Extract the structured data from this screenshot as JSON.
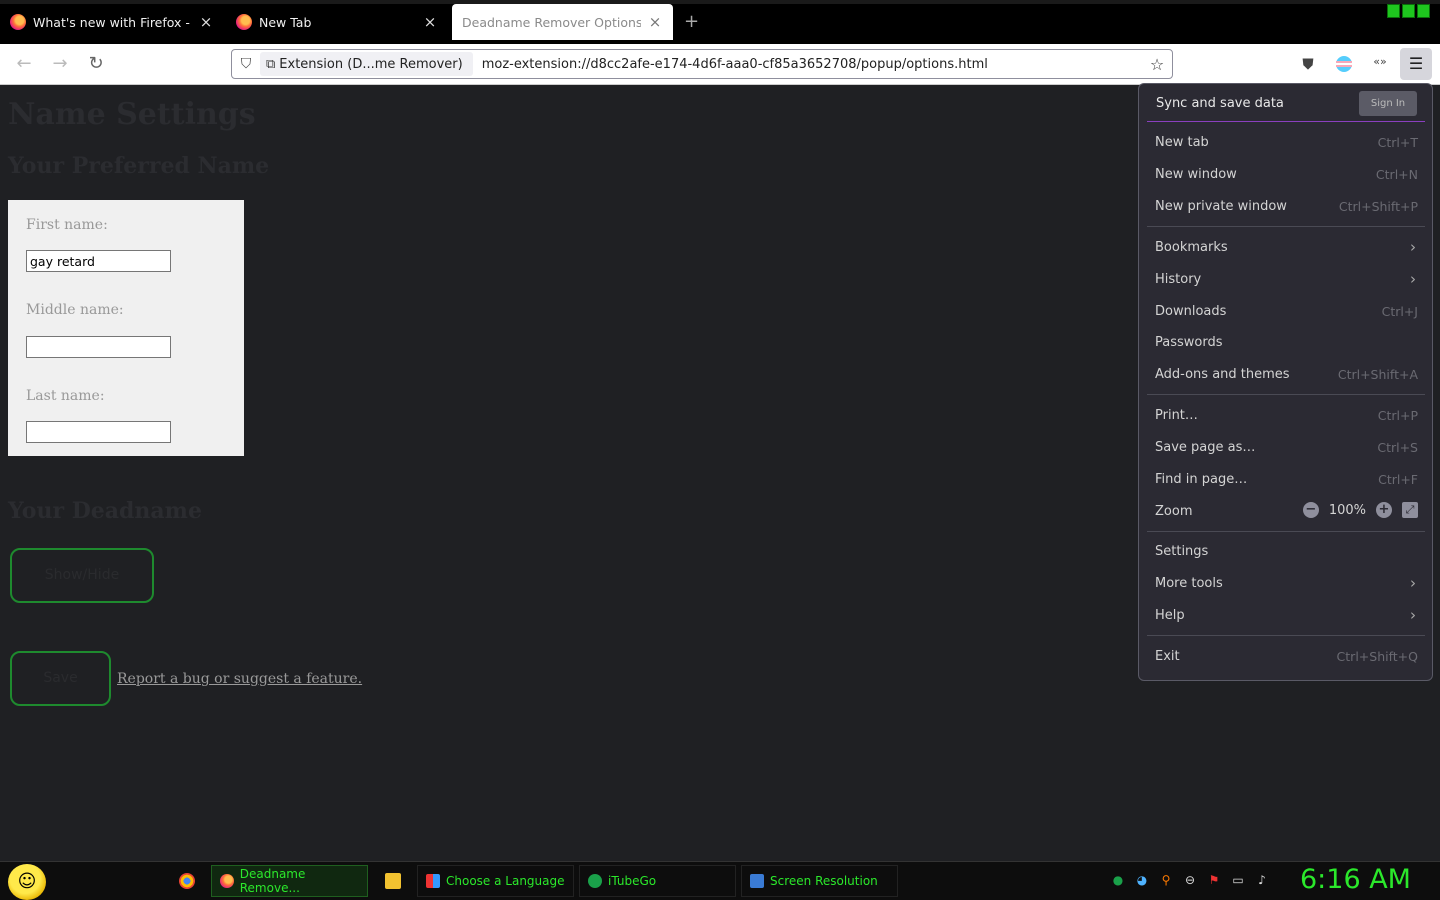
{
  "browser": {
    "tabs": [
      {
        "label": "What's new with Firefox - More",
        "active": false
      },
      {
        "label": "New Tab",
        "active": false
      },
      {
        "label": "Deadname Remover Options",
        "active": true
      }
    ],
    "new_tab_glyph": "+",
    "close_glyph": "×",
    "identity": "Extension (D...me Remover)",
    "url": "moz-extension://d8cc2afe-e174-4d6f-aaa0-cf85a3652708/popup/options.html"
  },
  "page": {
    "title": "Name Settings",
    "preferred_heading": "Your Preferred Name",
    "first_label": "First name:",
    "first_value": "gay retard",
    "middle_label": "Middle name:",
    "middle_value": "",
    "last_label": "Last name:",
    "last_value": "",
    "deadname_heading": "Your Deadname",
    "show_hide": "Show/Hide",
    "save": "Save",
    "report_link": "Report a bug or suggest a feature."
  },
  "app_menu": {
    "sync_title": "Sync and save data",
    "sign_in": "Sign In",
    "items": [
      {
        "label": "New tab",
        "shortcut": "Ctrl+T"
      },
      {
        "label": "New window",
        "shortcut": "Ctrl+N"
      },
      {
        "label": "New private window",
        "shortcut": "Ctrl+Shift+P"
      },
      {
        "label": "Bookmarks",
        "shortcut": ""
      },
      {
        "label": "History",
        "shortcut": ""
      },
      {
        "label": "Downloads",
        "shortcut": "Ctrl+J"
      },
      {
        "label": "Passwords",
        "shortcut": ""
      },
      {
        "label": "Add-ons and themes",
        "shortcut": "Ctrl+Shift+A"
      },
      {
        "label": "Print…",
        "shortcut": "Ctrl+P"
      },
      {
        "label": "Save page as…",
        "shortcut": "Ctrl+S"
      },
      {
        "label": "Find in page…",
        "shortcut": "Ctrl+F"
      },
      {
        "label": "Zoom",
        "shortcut": ""
      },
      {
        "label": "Settings",
        "shortcut": ""
      },
      {
        "label": "More tools",
        "shortcut": ""
      },
      {
        "label": "Help",
        "shortcut": ""
      },
      {
        "label": "Exit",
        "shortcut": "Ctrl+Shift+Q"
      }
    ],
    "zoom_value": "100%",
    "zoom_out": "−",
    "zoom_in": "+",
    "fullscreen": "⤢",
    "submenu_arrow": "›"
  },
  "taskbar": {
    "apps": [
      {
        "label": "Deadname Remove...",
        "icon": "firefox-icon",
        "active": true
      },
      {
        "label": "Choose a Language",
        "icon": "window-icon",
        "active": false
      },
      {
        "label": "iTubeGo",
        "icon": "itubego-icon",
        "active": false
      },
      {
        "label": "Screen Resolution",
        "icon": "monitor-icon",
        "active": false
      }
    ],
    "clock": "6:16 AM"
  },
  "colors": {
    "accent_green": "#2be82b",
    "button_border": "#1e8a2e",
    "page_bg": "#1f2023",
    "menu_bg": "#2b2a33"
  }
}
